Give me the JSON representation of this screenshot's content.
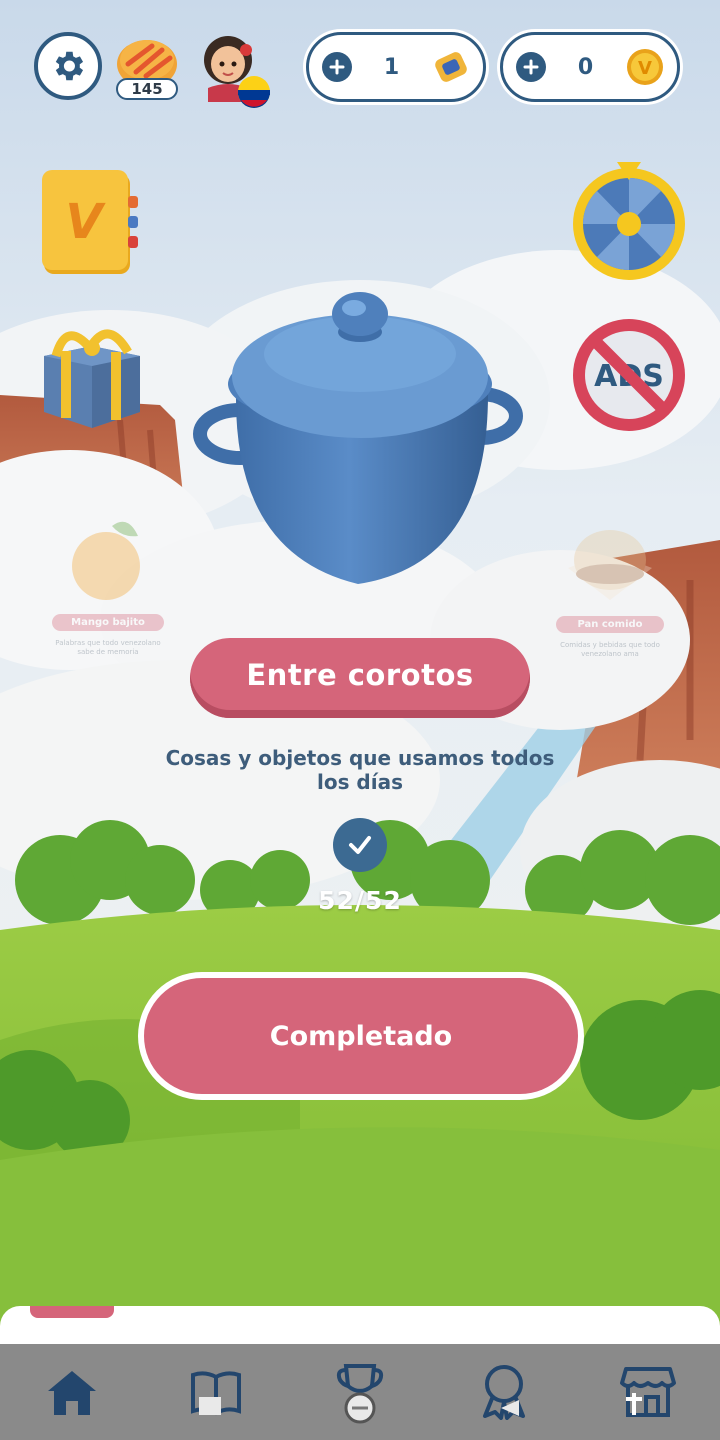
{
  "header": {
    "bread_count": "145",
    "power_count": "1",
    "coin_count": "0"
  },
  "level": {
    "title": "Entre corotos",
    "subtitle": "Cosas y objetos que usamos todos los días",
    "progress": "52/52",
    "status_button": "Completado"
  },
  "side_levels": {
    "left_title": "Mango bajito",
    "left_desc": "Palabras que todo venezolano sabe de memoria",
    "right_title": "Pan comido",
    "right_desc": "Comidas y bebidas que todo venezolano ama"
  },
  "noads_label": "ADS",
  "book_letter": "V",
  "coin_letter": "V",
  "nav": [
    "home-icon",
    "book-icon",
    "trophy-icon",
    "medal-icon",
    "store-icon"
  ],
  "colors": {
    "primary_blue": "#2f5a80",
    "accent_pink": "#d5657a",
    "grass_green": "#7dbb3a"
  }
}
